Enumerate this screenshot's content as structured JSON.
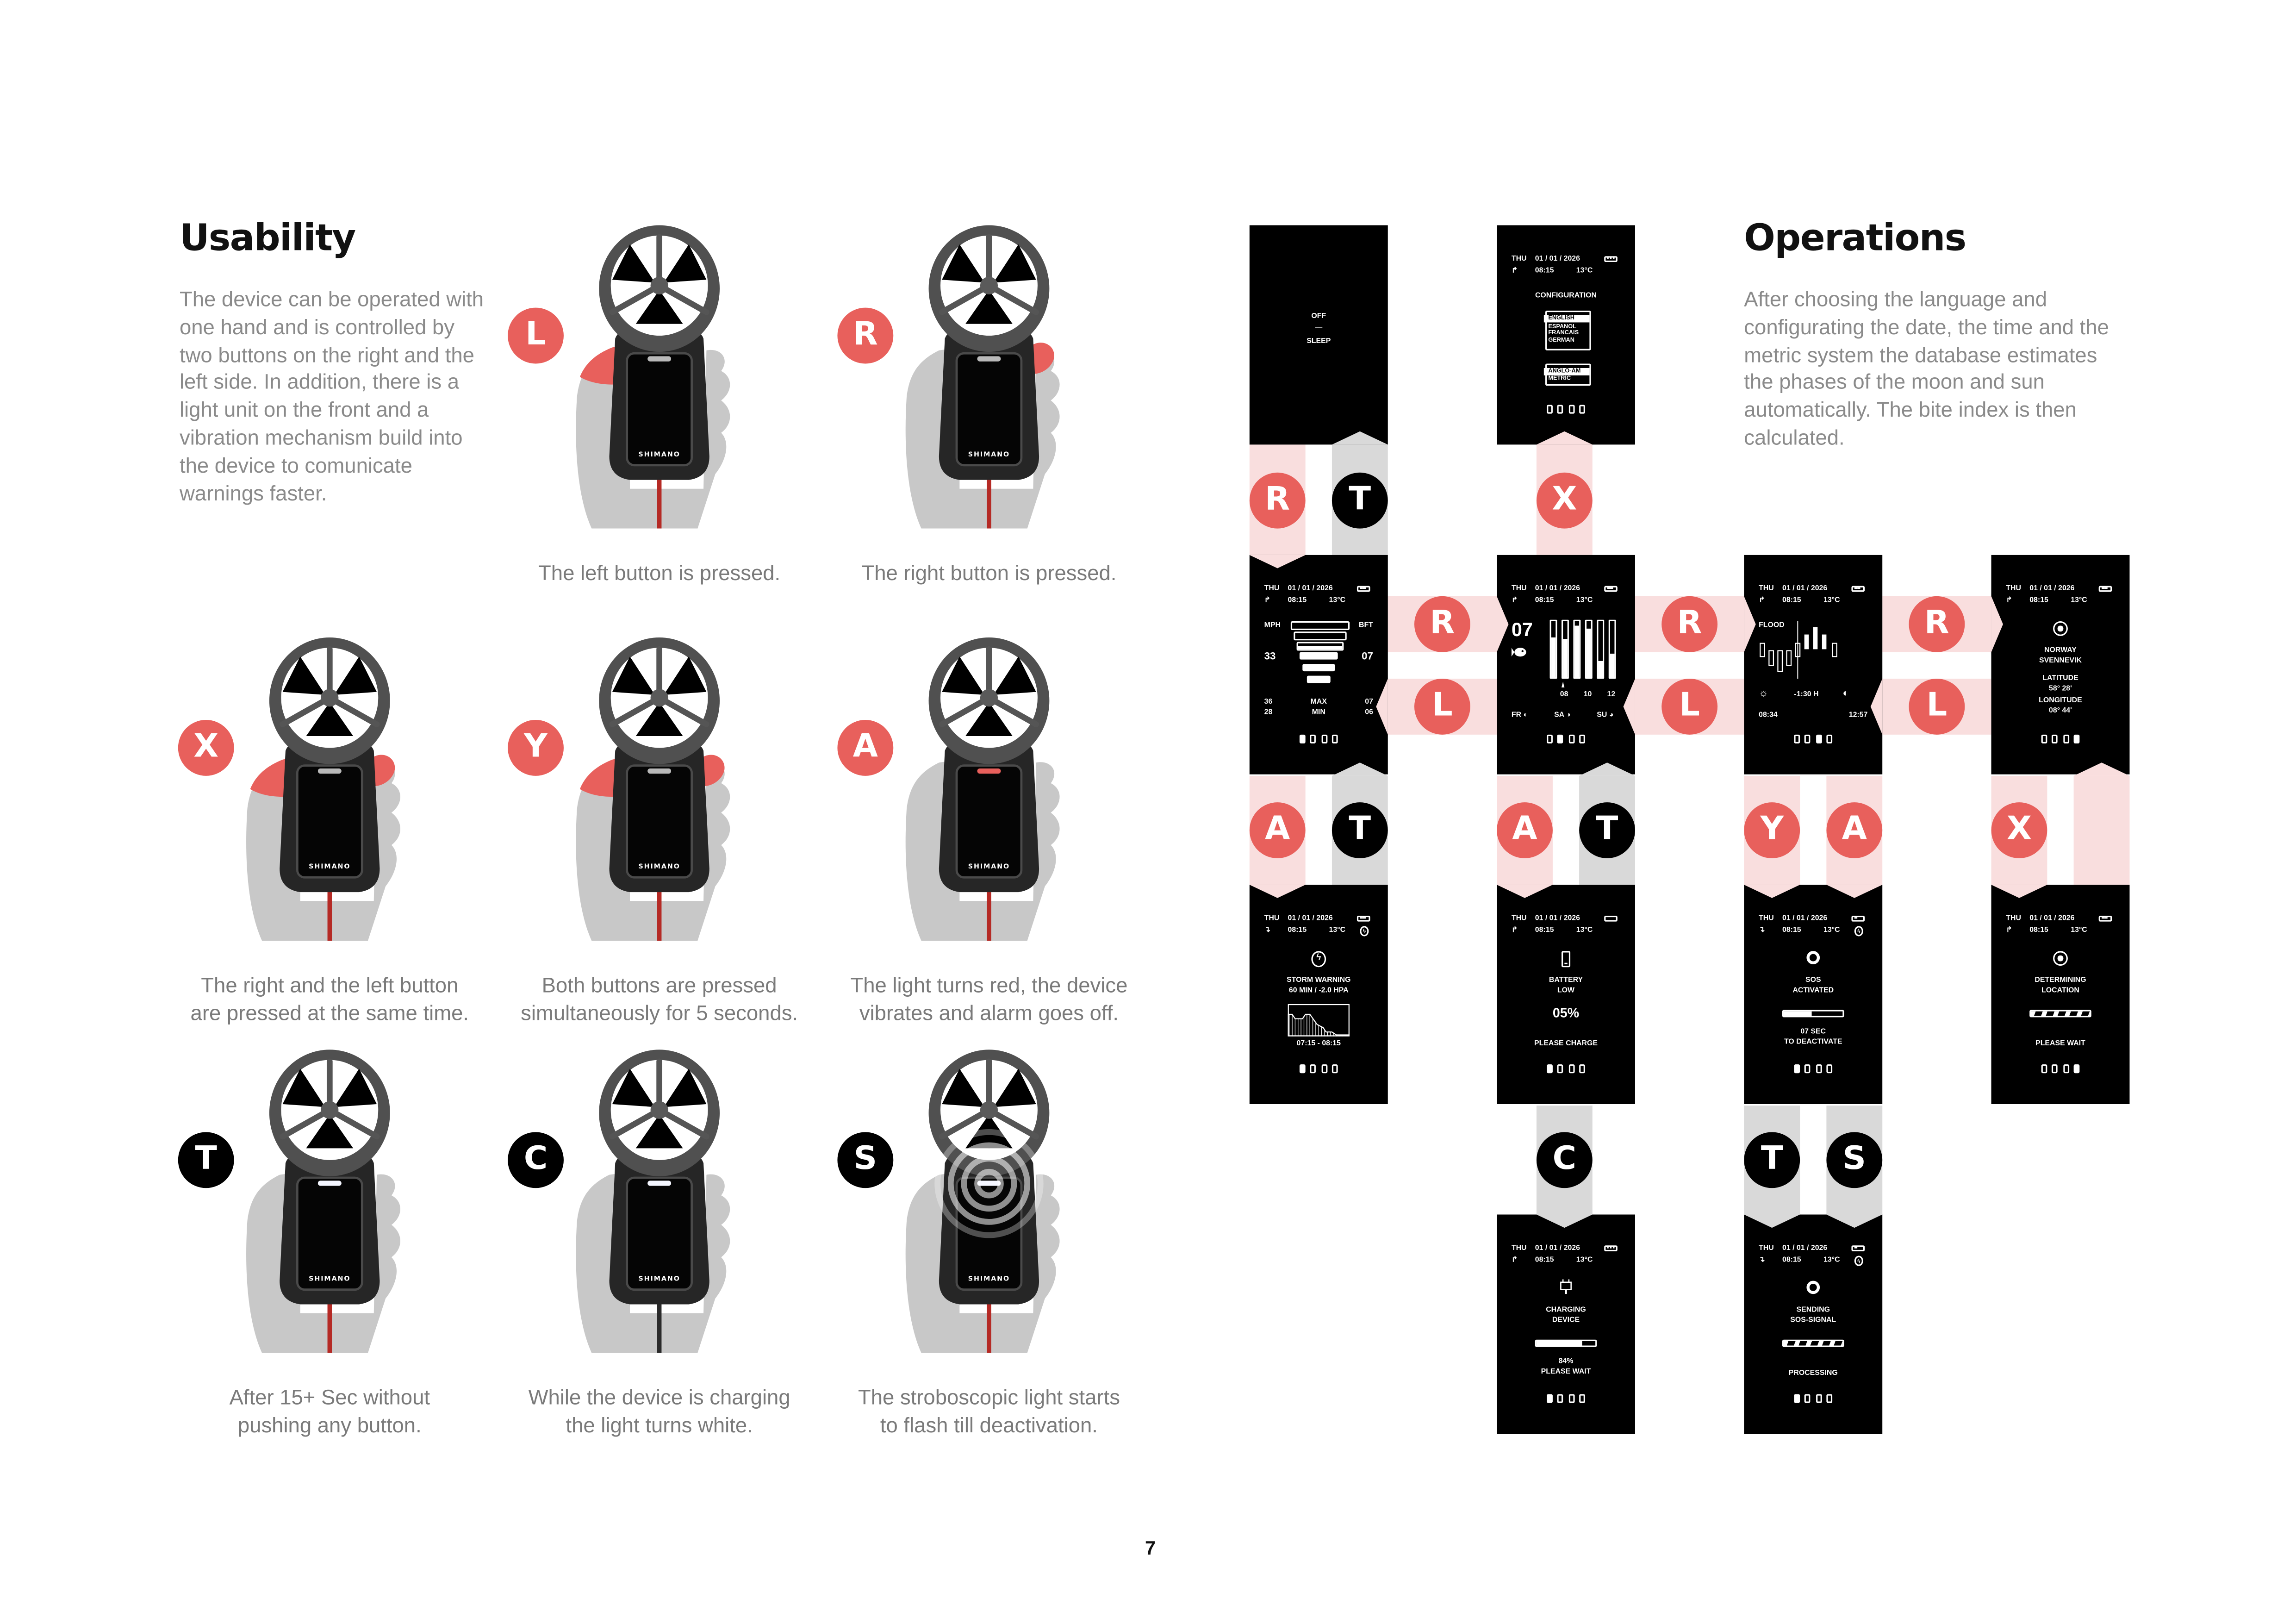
{
  "usability": {
    "title": "Usability",
    "description": "The device can be operated with one hand and is controlled by two buttons on the right and the left side. In addition, there is a light unit on the front and a vibration mechanism build into the device to comunicate warnings faster.",
    "brand": "SHIMANO",
    "items": [
      {
        "button": "L",
        "style": "pink",
        "caption_lines": [
          "The left button is pressed."
        ],
        "pressed": [
          "left"
        ],
        "light": "off",
        "cable": "normal"
      },
      {
        "button": "R",
        "style": "pink",
        "caption_lines": [
          "The right button is pressed."
        ],
        "pressed": [
          "right"
        ],
        "light": "off",
        "cable": "normal"
      },
      {
        "button": "X",
        "style": "pink",
        "caption_lines": [
          "The right and the left button",
          "are pressed at the same time."
        ],
        "pressed": [
          "left",
          "right"
        ],
        "light": "off",
        "cable": "normal"
      },
      {
        "button": "Y",
        "style": "pink",
        "caption_lines": [
          "Both buttons are pressed",
          "simultaneously for 5 seconds."
        ],
        "pressed": [
          "left",
          "right"
        ],
        "light": "off",
        "cable": "normal"
      },
      {
        "button": "A",
        "style": "pink",
        "caption_lines": [
          "The light turns red, the device",
          "vibrates and alarm goes off."
        ],
        "pressed": [],
        "light": "red",
        "cable": "normal"
      },
      {
        "button": "T",
        "style": "dark",
        "caption_lines": [
          "After 15+ Sec without",
          "pushing any button."
        ],
        "pressed": [],
        "light": "white",
        "cable": "normal"
      },
      {
        "button": "C",
        "style": "dark",
        "caption_lines": [
          "While the device is charging",
          "the light turns white."
        ],
        "pressed": [],
        "light": "white",
        "cable": "charging"
      },
      {
        "button": "S",
        "style": "dark",
        "caption_lines": [
          "The stroboscopic light starts",
          "to flash till deactivation."
        ],
        "pressed": [],
        "light": "strobe",
        "cable": "normal"
      }
    ]
  },
  "operations": {
    "title": "Operations",
    "description": "After choosing the language and configurating the date, the time and the metric system the database estimates the phases of the moon and sun automatically. The bite index is then calculated."
  },
  "status": {
    "day": "THU",
    "date": "01 / 01 / 2026",
    "time": "08:15",
    "temp": "13°C"
  },
  "screens": {
    "sleep": {
      "line1": "OFF",
      "dash": "—",
      "line2": "SLEEP"
    },
    "config": {
      "battery_level": 3,
      "title": "CONFIGURATION",
      "languages": [
        "ENGLISH",
        "ESPANOL",
        "FRANCAIS",
        "GERMAN"
      ],
      "selected_language": "ENGLISH",
      "units": [
        "ANGLO-AM",
        "METRIC"
      ],
      "selected_unit": "ANGLO-AM",
      "page": 0
    },
    "wind": {
      "battery_level": 2,
      "unit": "MPH",
      "scale": "BFT",
      "speed": "33",
      "bft": "07",
      "max_speed": "36",
      "min_speed": "28",
      "max_label": "MAX",
      "min_label": "MIN",
      "max_bft": "07",
      "min_bft": "06",
      "page": 1
    },
    "bite": {
      "battery_level": 2,
      "index": "07",
      "bars": [
        0.72,
        0.68,
        0.93,
        0.87,
        0.28,
        0.42
      ],
      "hours": [
        "08",
        "10",
        "12"
      ],
      "days": [
        "FR",
        "SA",
        "SU"
      ],
      "page": 2
    },
    "tide": {
      "battery_level": 2,
      "label": "FLOOD",
      "sunrise": "08:34",
      "offset": "-1:30 H",
      "moonrise": "12:57",
      "page": 3
    },
    "location": {
      "battery_level": 2,
      "country": "NORWAY",
      "place": "SVENNEVIK",
      "lat_label": "LATITUDE",
      "lat": "58° 28'",
      "lon_label": "LONGITUDE",
      "lon": "08° 44'",
      "page": 4
    },
    "storm": {
      "battery_level": 2,
      "line1": "STORM WARNING",
      "line2": "60 MIN / -2.0 HPA",
      "range": "07:15  -  08:15",
      "page": 1
    },
    "battery": {
      "battery_level": 0,
      "line1": "BATTERY",
      "line2": "LOW",
      "percent": "05%",
      "action": "PLEASE CHARGE",
      "page": 1
    },
    "sos": {
      "battery_level": 1,
      "line1": "SOS",
      "line2": "ACTIVATED",
      "progress": 0.5,
      "line3": "07 SEC",
      "line4": "TO DEACTIVATE",
      "page": 1
    },
    "locating": {
      "battery_level": 2,
      "line1": "DETERMINING",
      "line2": "LOCATION",
      "line3": "PLEASE WAIT",
      "page": 4
    },
    "charging": {
      "battery_level": 3,
      "line1": "CHARGING",
      "line2": "DEVICE",
      "progress": 0.84,
      "percent": "84%",
      "line3": "PLEASE WAIT",
      "page": 1
    },
    "sending": {
      "battery_level": 1,
      "line1": "SENDING",
      "line2": "SOS-SIGNAL",
      "line3": "PROCESSING",
      "page": 1
    }
  },
  "flow": {
    "transitions": [
      {
        "from": "sleep",
        "to": "wind",
        "button": "R",
        "style": "pink"
      },
      {
        "from": "wind",
        "to": "sleep",
        "button": "T",
        "style": "dark"
      },
      {
        "from": "bite",
        "to": "config",
        "button": "X",
        "style": "pink"
      },
      {
        "from": "wind",
        "to": "bite",
        "button": "R",
        "style": "pink"
      },
      {
        "from": "bite",
        "to": "wind",
        "button": "L",
        "style": "pink"
      },
      {
        "from": "bite",
        "to": "tide",
        "button": "R",
        "style": "pink"
      },
      {
        "from": "tide",
        "to": "bite",
        "button": "L",
        "style": "pink"
      },
      {
        "from": "tide",
        "to": "location",
        "button": "R",
        "style": "pink"
      },
      {
        "from": "location",
        "to": "tide",
        "button": "L",
        "style": "pink"
      },
      {
        "from": "wind",
        "to": "storm",
        "button": "A",
        "style": "pink"
      },
      {
        "from": "storm",
        "to": "wind",
        "button": "T",
        "style": "dark"
      },
      {
        "from": "bite",
        "to": "battery",
        "button": "A",
        "style": "pink"
      },
      {
        "from": "battery",
        "to": "bite",
        "button": "T",
        "style": "dark"
      },
      {
        "from": "tide",
        "to": "sos",
        "button": "Y",
        "style": "pink"
      },
      {
        "from": "tide",
        "to": "sos",
        "button": "A",
        "style": "pink"
      },
      {
        "from": "location",
        "to": "locating",
        "button": "X",
        "style": "pink"
      },
      {
        "from": "locating",
        "to": "location",
        "button": null,
        "style": "pink"
      },
      {
        "from": "battery",
        "to": "charging",
        "button": "C",
        "style": "dark"
      },
      {
        "from": "sos",
        "to": "sending",
        "button": "T",
        "style": "dark"
      },
      {
        "from": "sos",
        "to": "sending",
        "button": "S",
        "style": "dark"
      }
    ]
  },
  "colors": {
    "accent": "#E8605C",
    "accent_light": "#F9DEDE",
    "auto": "#D9D9D9",
    "screen": "#000000"
  },
  "page_number": "7"
}
